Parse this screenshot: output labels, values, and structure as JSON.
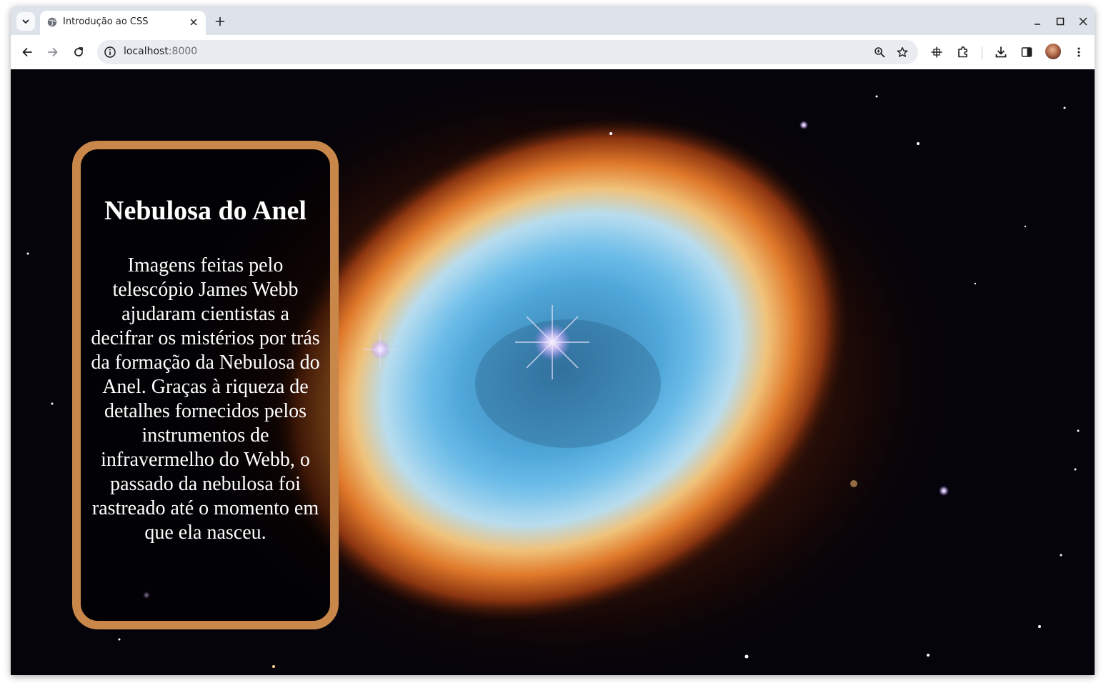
{
  "browser": {
    "tab": {
      "title": "Introdução ao CSS",
      "favicon": "globe-icon"
    },
    "address_bar": {
      "host": "localhost",
      "port": ":8000"
    },
    "toolbar_icons": [
      "back-arrow-icon",
      "forward-arrow-icon",
      "reload-icon",
      "site-info-icon",
      "zoom-icon",
      "bookmark-star-icon",
      "move-icon",
      "extensions-icon",
      "download-icon",
      "side-panel-icon",
      "avatar",
      "menu-kebab-icon"
    ],
    "window_controls": [
      "minimize-icon",
      "maximize-icon",
      "close-icon"
    ]
  },
  "page": {
    "heading": "Nebulosa do Anel",
    "paragraph": "Imagens feitas pelo telescópio James Webb ajudaram cientistas a decifrar os mistérios por trás da formação da Nebulosa do Anel. Graças à riqueza de detalhes fornecidos pelos instrumentos de infravermelho do Webb, o passado da nebulosa foi rastreado até o momento em que ela nasceu.",
    "background_image": "Southern Ring Nebula (James Webb)",
    "colors": {
      "card_border": "#c9874a",
      "text": "#ffffff"
    }
  }
}
